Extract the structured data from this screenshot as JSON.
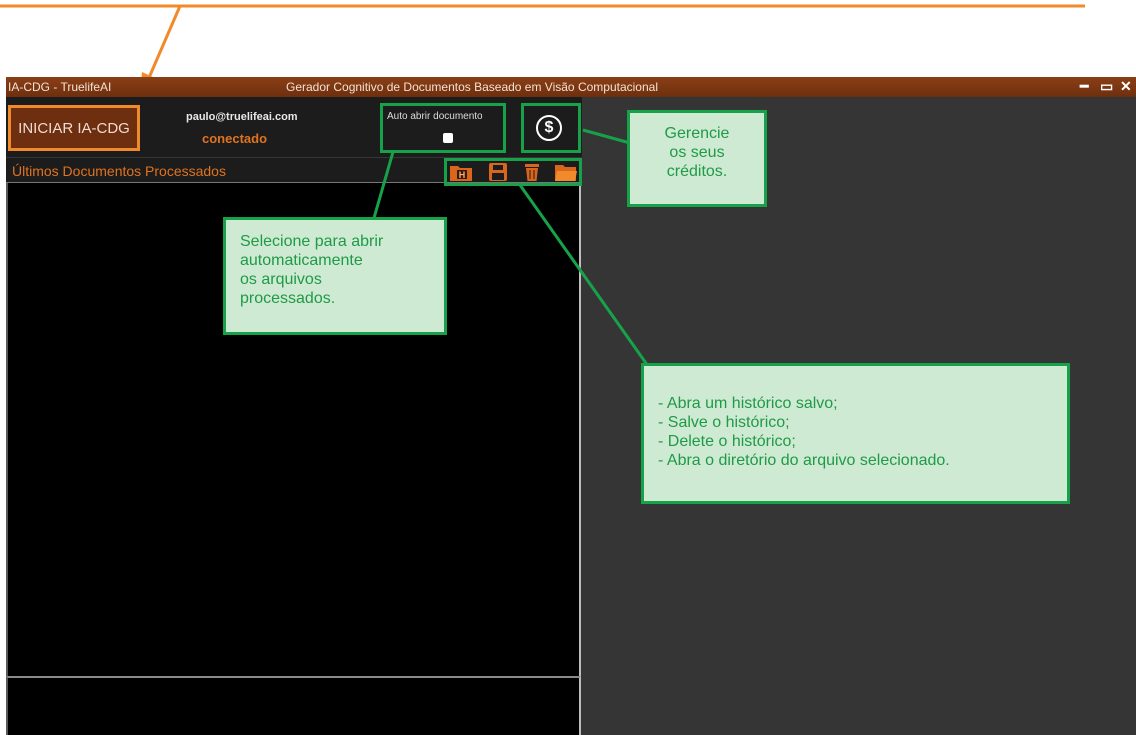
{
  "window": {
    "app_title": "IA-CDG - TruelifeAI",
    "center_title": "Gerador Cognitivo de Documentos Baseado em Visão Computacional",
    "minimize_label": "━",
    "maximize_label": "▭",
    "close_label": "✕"
  },
  "toolbar": {
    "start_button_label": "INICIAR IA-CDG",
    "user_email": "paulo@truelifeai.com",
    "user_status": "conectado",
    "auto_open_label": "Auto abrir documento",
    "credits_icon": "dollar-coin-icon",
    "credits_symbol": "$"
  },
  "documents_panel": {
    "title": "Últimos Documentos Processados",
    "tools": [
      {
        "icon": "open-history-icon"
      },
      {
        "icon": "save-icon"
      },
      {
        "icon": "trash-icon"
      },
      {
        "icon": "folder-icon"
      }
    ]
  },
  "callouts": {
    "credits_text": [
      "Gerencie",
      "os seus",
      "créditos."
    ],
    "auto_open_text": [
      "Selecione para abrir",
      "automaticamente",
      "os arquivos",
      "processados."
    ],
    "tools_text": [
      "- Abra um histórico salvo;",
      "- Salve o histórico;",
      "- Delete o histórico;",
      "- Abra o diretório do arquivo selecionado."
    ]
  },
  "colors": {
    "accent_orange": "#e0731f",
    "titlebar_brown": "#7a3612",
    "callout_green": "#17a24a",
    "callout_fill": "#cfead3"
  }
}
